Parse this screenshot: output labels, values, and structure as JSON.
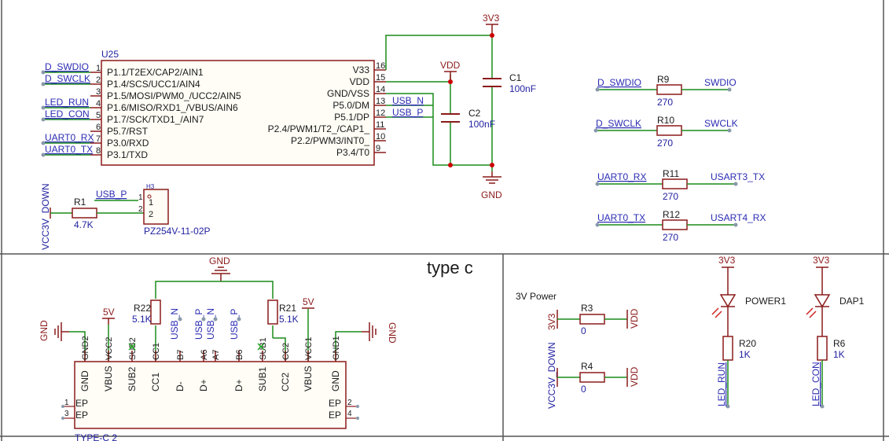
{
  "colors": {
    "wire": "#1a8c1a",
    "body": "#8b1a1a",
    "pin": "#8b1a1a",
    "net": "#2b2bb3",
    "ref": "#1f1fa0",
    "text": "#1a1a1a",
    "junction": "#cc0000",
    "border": "#555555",
    "noconnect": "#22aa22"
  },
  "u25": {
    "ref": "U25",
    "left_pins": [
      {
        "num": "1",
        "name": "P1.1/T2EX/CAP2/AIN1",
        "net": "D_SWDIO"
      },
      {
        "num": "2",
        "name": "P1.4/SCS/UCC1/AIN4",
        "net": "D_SWCLK"
      },
      {
        "num": "3",
        "name": "P1.5/MOSI/PWM0_/UCC2/AIN5",
        "net": ""
      },
      {
        "num": "4",
        "name": "P1.6/MISO/RXD1_/VBUS/AIN6",
        "net": "LED_RUN"
      },
      {
        "num": "5",
        "name": "P1.7/SCK/TXD1_/AIN7",
        "net": "LED_CON"
      },
      {
        "num": "6",
        "name": "P5.7/RST",
        "net": ""
      },
      {
        "num": "7",
        "name": "P3.0/RXD",
        "net": "UART0_RX"
      },
      {
        "num": "8",
        "name": "P3.1/TXD",
        "net": "UART0_TX"
      }
    ],
    "right_pins": [
      {
        "num": "16",
        "name": "V33",
        "net": ""
      },
      {
        "num": "15",
        "name": "VDD",
        "net": ""
      },
      {
        "num": "14",
        "name": "GND/VSS",
        "net": ""
      },
      {
        "num": "13",
        "name": "P5.0/DM",
        "net": "USB_N"
      },
      {
        "num": "12",
        "name": "P5.1/DP",
        "net": "USB_P"
      },
      {
        "num": "11",
        "name": "P2.4/PWM1/T2_/CAP1_",
        "net": ""
      },
      {
        "num": "10",
        "name": "P2.2/PWM3/INT0_",
        "net": ""
      },
      {
        "num": "9",
        "name": "P3.4/T0",
        "net": ""
      }
    ]
  },
  "power": {
    "v3v3": "3V3",
    "vdd": "VDD",
    "gnd": "GND",
    "v5": "5V",
    "vcc3v_down": "VCC3V_DOWN",
    "v3v": "3V3"
  },
  "caps": [
    {
      "ref": "C1",
      "value": "100nF"
    },
    {
      "ref": "C2",
      "value": "100nF"
    }
  ],
  "r1": {
    "ref": "R1",
    "value": "4.7K",
    "net_left": "VCC3V_DOWN"
  },
  "h3": {
    "ref": "H3",
    "part": "PZ254V-11-02P",
    "pin1": "1",
    "pin2": "2",
    "pin1_num": "1",
    "pin2_num": "2",
    "net": "USB_P"
  },
  "series_resistors": [
    {
      "ref": "R9",
      "value": "270",
      "left": "D_SWDIO",
      "right": "SWDIO"
    },
    {
      "ref": "R10",
      "value": "270",
      "left": "D_SWCLK",
      "right": "SWCLK"
    },
    {
      "ref": "R11",
      "value": "270",
      "left": "UART0_RX",
      "right": "USART3_TX"
    },
    {
      "ref": "R12",
      "value": "270",
      "left": "UART0_TX",
      "right": "USART4_RX"
    }
  ],
  "typec_section": {
    "title": "type c",
    "conn_ref": "TYPE-C 2",
    "pins": [
      "GND",
      "VBUS",
      "SUB2",
      "CC1",
      "D-",
      "B7",
      "D+",
      "A6",
      "A7",
      "D+",
      "B6",
      "SUB1",
      "CC2",
      "VBUS",
      "GND"
    ],
    "pins_visible": [
      "GND",
      "VBUS",
      "SUB2",
      "CC1",
      "D-",
      "D+",
      "D+",
      "SUB1",
      "CC2",
      "VBUS",
      "GND"
    ],
    "pin_nums_top": [
      "GND2",
      "VCC2",
      "SUB2",
      "CC1",
      "B7",
      "A6",
      "A7",
      "B6",
      "SUB1",
      "CC2",
      "VCC1",
      "GND1"
    ],
    "ep_left": [
      {
        "num": "1",
        "name": "EP"
      },
      {
        "num": "3",
        "name": "EP"
      }
    ],
    "ep_right": [
      {
        "num": "2",
        "name": "EP"
      },
      {
        "num": "4",
        "name": "EP"
      }
    ],
    "nets": [
      "USB_N",
      "USB_P",
      "USB_N",
      "USB_P"
    ],
    "r22": {
      "ref": "R22",
      "value": "5.1K"
    },
    "r21": {
      "ref": "R21",
      "value": "5.1K"
    }
  },
  "power3v_section": {
    "title": "3V Power",
    "r3": {
      "ref": "R3",
      "value": "0",
      "left": "3V3",
      "right": "VDD"
    },
    "r4": {
      "ref": "R4",
      "value": "0",
      "left": "VCC3V_DOWN",
      "right": "VDD"
    }
  },
  "leds": [
    {
      "ref": "POWER1",
      "rref": "R20",
      "rvalue": "1K",
      "supply": "3V3",
      "net": "LED_RUN"
    },
    {
      "ref": "DAP1",
      "rref": "R6",
      "rvalue": "1K",
      "supply": "3V3",
      "net": "LED_CON"
    }
  ]
}
